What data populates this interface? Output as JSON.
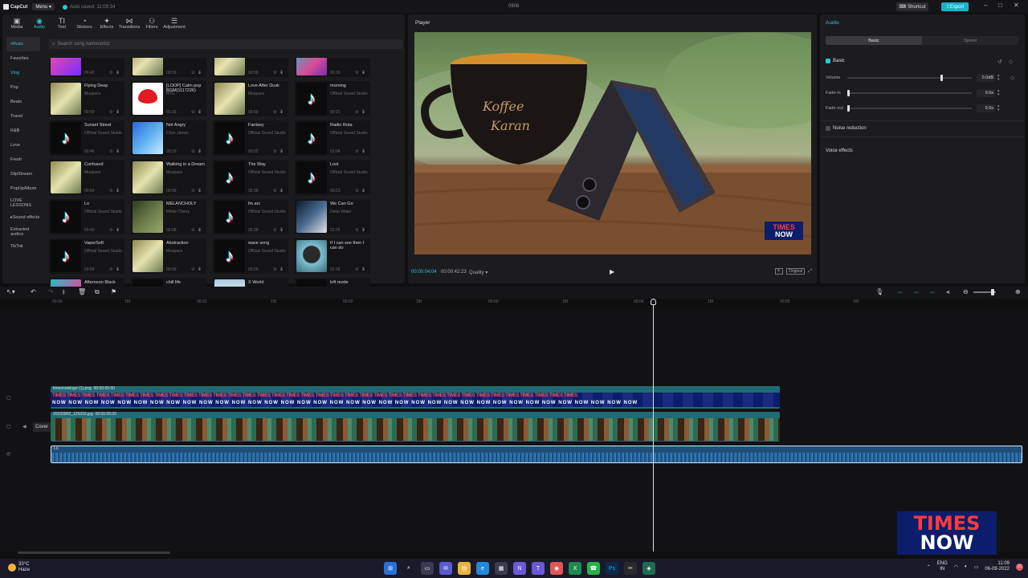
{
  "titlebar": {
    "app_name": "CapCut",
    "menu_label": "Menu",
    "autosave": "Auto saved: 11:09:34",
    "project_name": "0906",
    "shortcut_label": "Shortcut",
    "export_label": "Export"
  },
  "toolbar": {
    "items": [
      {
        "label": "Media",
        "icon": "media-icon"
      },
      {
        "label": "Audio",
        "icon": "audio-icon"
      },
      {
        "label": "Text",
        "icon": "text-icon"
      },
      {
        "label": "Stickers",
        "icon": "stickers-icon"
      },
      {
        "label": "Effects",
        "icon": "effects-icon"
      },
      {
        "label": "Transitions",
        "icon": "transitions-icon"
      },
      {
        "label": "Filters",
        "icon": "filters-icon"
      },
      {
        "label": "Adjustment",
        "icon": "adjustment-icon"
      }
    ]
  },
  "categories": [
    "Music",
    "Favorites",
    "Vlog",
    "Pop",
    "Beats",
    "Travel",
    "R&B",
    "Love",
    "Fresh",
    "SlipStream",
    "PopUpAlbum",
    "LOVE LESSONS",
    "Sound effects",
    "Extracted audios",
    "TikTok"
  ],
  "search_placeholder": "Search song name/artist",
  "songs": [
    {
      "name": "",
      "artist": "",
      "dur": "00:42",
      "thumb": "pink"
    },
    {
      "name": "",
      "artist": "",
      "dur": "00:59",
      "thumb": "musicpic"
    },
    {
      "name": "",
      "artist": "",
      "dur": "00:59",
      "thumb": "musicpic"
    },
    {
      "name": "",
      "artist": "",
      "dur": "00:19",
      "thumb": "neon"
    },
    {
      "name": "Flying Deep",
      "artist": "Muspace",
      "dur": "00:59",
      "thumb": "musicpic"
    },
    {
      "name": "[LOOP] Calm pop BGM(1117226)",
      "artist": "RYU",
      "dur": "01:33",
      "thumb": "redwhite"
    },
    {
      "name": "Love After Dusk",
      "artist": "Muspace",
      "dur": "00:59",
      "thumb": "musicpic"
    },
    {
      "name": "morning",
      "artist": "Official Sound Studio",
      "dur": "00:21",
      "thumb": "tiktok"
    },
    {
      "name": "Sunset Street",
      "artist": "Official Sound Studio",
      "dur": "00:46",
      "thumb": "tiktok"
    },
    {
      "name": "Not Angry",
      "artist": "Chris James",
      "dur": "03:19",
      "thumb": "blue"
    },
    {
      "name": "Fantasy",
      "artist": "Official Sound Studio",
      "dur": "00:22",
      "thumb": "tiktok"
    },
    {
      "name": "Radio Rota",
      "artist": "Official Sound Studio",
      "dur": "01:04",
      "thumb": "tiktok"
    },
    {
      "name": "Confused",
      "artist": "Muspace",
      "dur": "00:59",
      "thumb": "musicpic"
    },
    {
      "name": "Walking in a Dream",
      "artist": "Muspace",
      "dur": "00:56",
      "thumb": "musicpic"
    },
    {
      "name": "The Way",
      "artist": "Official Sound Studio",
      "dur": "00:36",
      "thumb": "tiktok"
    },
    {
      "name": "Lost",
      "artist": "Official Sound Studio",
      "dur": "00:23",
      "thumb": "tiktok"
    },
    {
      "name": "Lo",
      "artist": "Official Sound Studio",
      "dur": "00:43",
      "thumb": "tiktok"
    },
    {
      "name": "MELANCHOLY",
      "artist": "White Cherry",
      "dur": "02:08",
      "thumb": "forest"
    },
    {
      "name": "fm.arc",
      "artist": "Official Sound Studio",
      "dur": "00:39",
      "thumb": "tiktok"
    },
    {
      "name": "We Can Go",
      "artist": "Deep Water",
      "dur": "02:25",
      "thumb": "newsy"
    },
    {
      "name": "VaporSoft",
      "artist": "Official Sound Studio",
      "dur": "00:59",
      "thumb": "tiktok"
    },
    {
      "name": "Abstraction",
      "artist": "Muspace",
      "dur": "00:59",
      "thumb": "musicpic"
    },
    {
      "name": "wave song",
      "artist": "Official Sound Studio",
      "dur": "00:25",
      "thumb": "tiktok"
    },
    {
      "name": "If I can see then I can do",
      "artist": "",
      "dur": "02:26",
      "thumb": "portrait"
    },
    {
      "name": "Afternoon Black",
      "artist": "Muspace",
      "dur": "",
      "thumb": "neon"
    },
    {
      "name": "chill life",
      "artist": "Official Sound Studio",
      "dur": "",
      "thumb": "tiktok"
    },
    {
      "name": "X World",
      "artist": "Muspace",
      "dur": "",
      "thumb": "sky"
    },
    {
      "name": "loft mode",
      "artist": "Official Sound Studio",
      "dur": "",
      "thumb": "tiktok"
    }
  ],
  "player": {
    "title": "Player",
    "current_time": "00:00:04:04",
    "total_time": "00:00:42:23",
    "quality_label": "Quality",
    "original_label": "Original",
    "video_logo_top": "TIMES",
    "video_logo_bottom": "NOW"
  },
  "audio_panel": {
    "title": "Audio",
    "tab_basic": "Basic",
    "tab_speed": "Speed",
    "basic_label": "Basic",
    "volume_label": "Volume",
    "volume_value": "0.0dB",
    "volume_level": 0.75,
    "fadein_label": "Fade-in",
    "fadein_value": "0.0s",
    "fadeout_label": "Fade-out",
    "fadeout_value": "0.0s",
    "noise_label": "Noise reduction",
    "voice_label": "Voice effects"
  },
  "timeline": {
    "ruler": [
      "00:00",
      "15f",
      "00:01",
      "15f",
      "00:02",
      "15f",
      "00:03",
      "15f",
      "00:04",
      "15f",
      "00:05",
      "15f"
    ],
    "clip1_name": "timesnowlogo (1).png",
    "clip1_dur": "00:00:05:00",
    "clip2_name": "20220902_125316.jpg",
    "clip2_dur": "00:00:05:00",
    "clip3_name": "Lo",
    "cover_label": "Cover",
    "logo_text_top": "TIMES",
    "logo_text_bottom": "NOW"
  },
  "taskbar": {
    "temp": "33°C",
    "weather": "Haze",
    "lang1": "ENG",
    "lang2": "IN",
    "time": "11:09",
    "date": "06-09-2022",
    "notif": "20"
  },
  "colors": {
    "accent": "#2fc2d6",
    "clip_teal": "#1f6b73",
    "audio_clip": "#1e4f7a",
    "times_now_blue": "#0c1d6b",
    "times_now_red": "#ff3b3b"
  }
}
